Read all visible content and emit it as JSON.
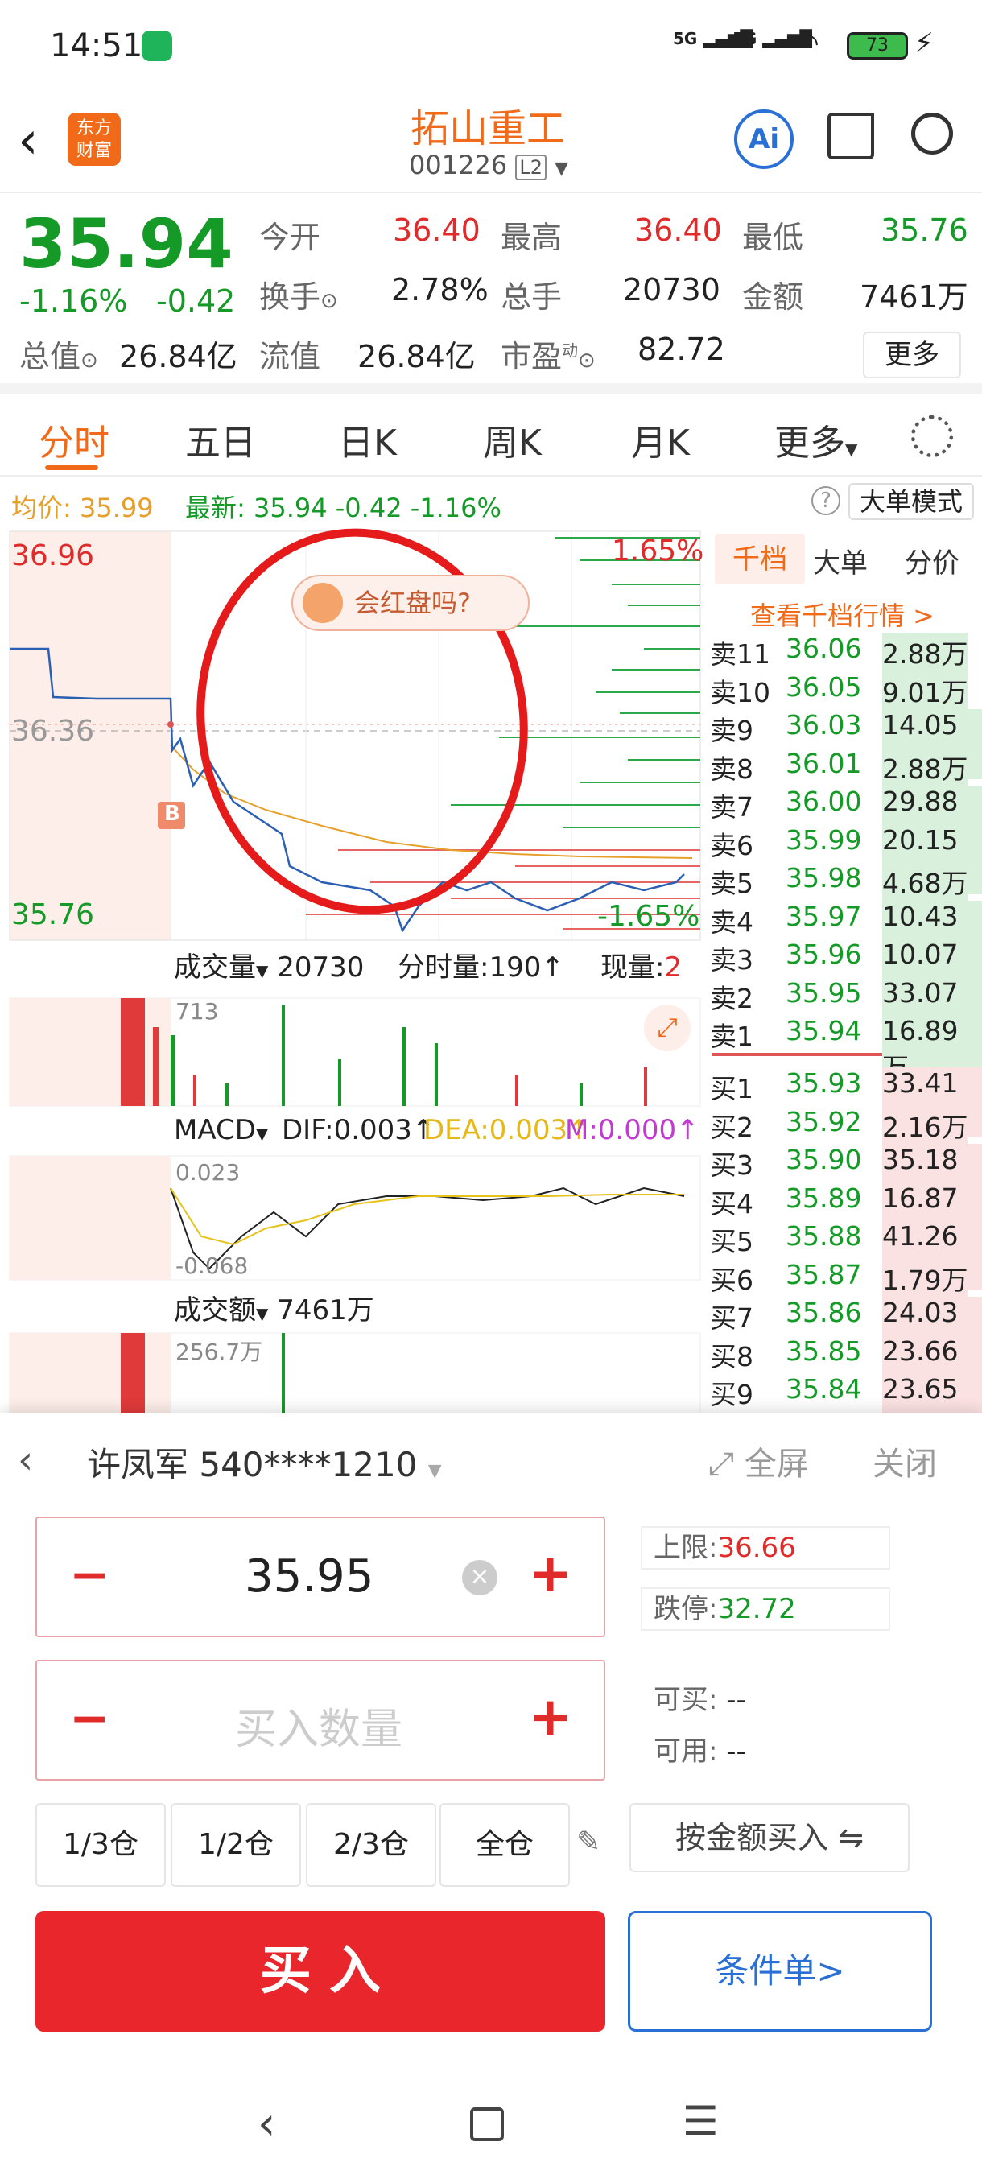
{
  "status_bar": {
    "time": "14:51",
    "net1": "5G",
    "net2": "5G",
    "battery": "73"
  },
  "header": {
    "logo_line1": "东方",
    "logo_line2": "财富",
    "title": "拓山重工",
    "code": "001226",
    "level": "L2",
    "ai": "Ai"
  },
  "quote": {
    "price": "35.94",
    "change_pct": "-1.16%",
    "change": "-0.42",
    "open_label": "今开",
    "open": "36.40",
    "high_label": "最高",
    "high": "36.40",
    "low_label": "最低",
    "low": "35.76",
    "turnover_label": "换手",
    "turnover": "2.78%",
    "volume_label": "总手",
    "volume": "20730",
    "amount_label": "金额",
    "amount": "7461万",
    "mcap_label": "总值",
    "mcap": "26.84亿",
    "float_label": "流值",
    "float": "26.84亿",
    "pe_label": "市盈",
    "pe_sup": "动",
    "pe": "82.72",
    "more": "更多"
  },
  "tabs": [
    "分时",
    "五日",
    "日K",
    "周K",
    "月K",
    "更多"
  ],
  "avg": {
    "label": "均价:",
    "value": "35.99",
    "latest_label": "最新:",
    "latest": "35.94",
    "chg": "-0.42",
    "pct": "-1.16%",
    "mode": "大单模式"
  },
  "chart": {
    "top": "36.96",
    "mid": "36.36",
    "bottom": "35.76",
    "pct_top": "1.65%",
    "pct_bottom": "-1.65%",
    "bubble": "会红盘吗?",
    "marker": "B",
    "vol_label": "成交量",
    "vol_total": "20730",
    "tick_label": "分时量:190",
    "cur_label": "现量:",
    "cur": "2",
    "vol_max": "713",
    "macd_label": "MACD",
    "dif": "DIF:0.003",
    "dea": "DEA:0.003",
    "m": "M:0.000",
    "macd_top": "0.023",
    "macd_bottom": "-0.068",
    "amt_label": "成交额",
    "amt_total": "7461万",
    "amt_max": "256.7万"
  },
  "orderbook": {
    "tab1": "千档",
    "tab2": "大单",
    "tab3": "分价",
    "link": "查看千档行情 >",
    "sells": [
      [
        "卖11",
        "36.06",
        "2.88万"
      ],
      [
        "卖10",
        "36.05",
        "9.01万"
      ],
      [
        "卖9",
        "36.03",
        "14.05万"
      ],
      [
        "卖8",
        "36.01",
        "2.88万"
      ],
      [
        "卖7",
        "36.00",
        "29.88万"
      ],
      [
        "卖6",
        "35.99",
        "20.15万"
      ],
      [
        "卖5",
        "35.98",
        "4.68万"
      ],
      [
        "卖4",
        "35.97",
        "10.43万"
      ],
      [
        "卖3",
        "35.96",
        "10.07万"
      ],
      [
        "卖2",
        "35.95",
        "33.07万"
      ],
      [
        "卖1",
        "35.94",
        "16.89万"
      ]
    ],
    "buys": [
      [
        "买1",
        "35.93",
        "33.41万"
      ],
      [
        "买2",
        "35.92",
        "2.16万"
      ],
      [
        "买3",
        "35.90",
        "35.18万"
      ],
      [
        "买4",
        "35.89",
        "16.87万"
      ],
      [
        "买5",
        "35.88",
        "41.26万"
      ],
      [
        "买6",
        "35.87",
        "1.79万"
      ],
      [
        "买7",
        "35.86",
        "24.03万"
      ],
      [
        "买8",
        "35.85",
        "23.66万"
      ],
      [
        "买9",
        "35.84",
        "23.65万"
      ]
    ]
  },
  "trade": {
    "account": "许凤军 540****1210",
    "fullscreen": "全屏",
    "close": "关闭",
    "price": "35.95",
    "qty_placeholder": "买入数量",
    "upper_label": "上限:",
    "upper": "36.66",
    "lower_label": "跌停:",
    "lower": "32.72",
    "canbuy_label": "可买:",
    "canbuy": "--",
    "avail_label": "可用:",
    "avail": "--",
    "pos": [
      "1/3仓",
      "1/2仓",
      "2/3仓",
      "全仓"
    ],
    "by_amount": "按金额买入",
    "buy": "买 入",
    "cond": "条件单>"
  },
  "colors": {
    "up": "#e02b2b",
    "down": "#159a28",
    "accent": "#f06a1a",
    "blue": "#2a6fd6"
  }
}
